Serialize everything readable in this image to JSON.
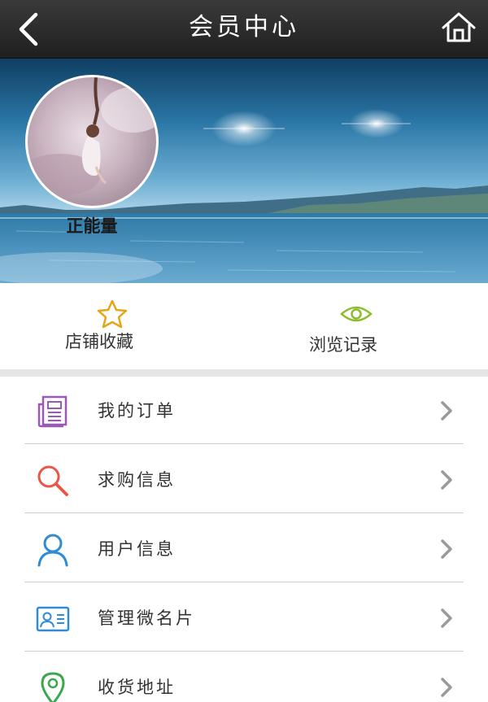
{
  "header": {
    "title": "会员中心",
    "back_icon": "chevron-left-icon",
    "home_icon": "home-icon"
  },
  "profile": {
    "username": "正能量"
  },
  "quick_links": [
    {
      "label": "店铺收藏",
      "icon": "star-icon",
      "color": "#e6a417"
    },
    {
      "label": "浏览记录",
      "icon": "eye-icon",
      "color": "#8dbd2b"
    }
  ],
  "menu": [
    {
      "label": "我的订单",
      "icon": "order-document-icon",
      "color": "#9b59b6"
    },
    {
      "label": "求购信息",
      "icon": "search-icon",
      "color": "#e8574a"
    },
    {
      "label": "用户信息",
      "icon": "user-icon",
      "color": "#2f8bd6"
    },
    {
      "label": "管理微名片",
      "icon": "contact-card-icon",
      "color": "#2f8bd6"
    },
    {
      "label": "收货地址",
      "icon": "location-pin-icon",
      "color": "#3aa84f"
    }
  ],
  "colors": {
    "header_bg": "#262626",
    "divider": "#cfcfcf",
    "section_gap": "#e6e6e6",
    "chevron": "#9a9a9a"
  }
}
